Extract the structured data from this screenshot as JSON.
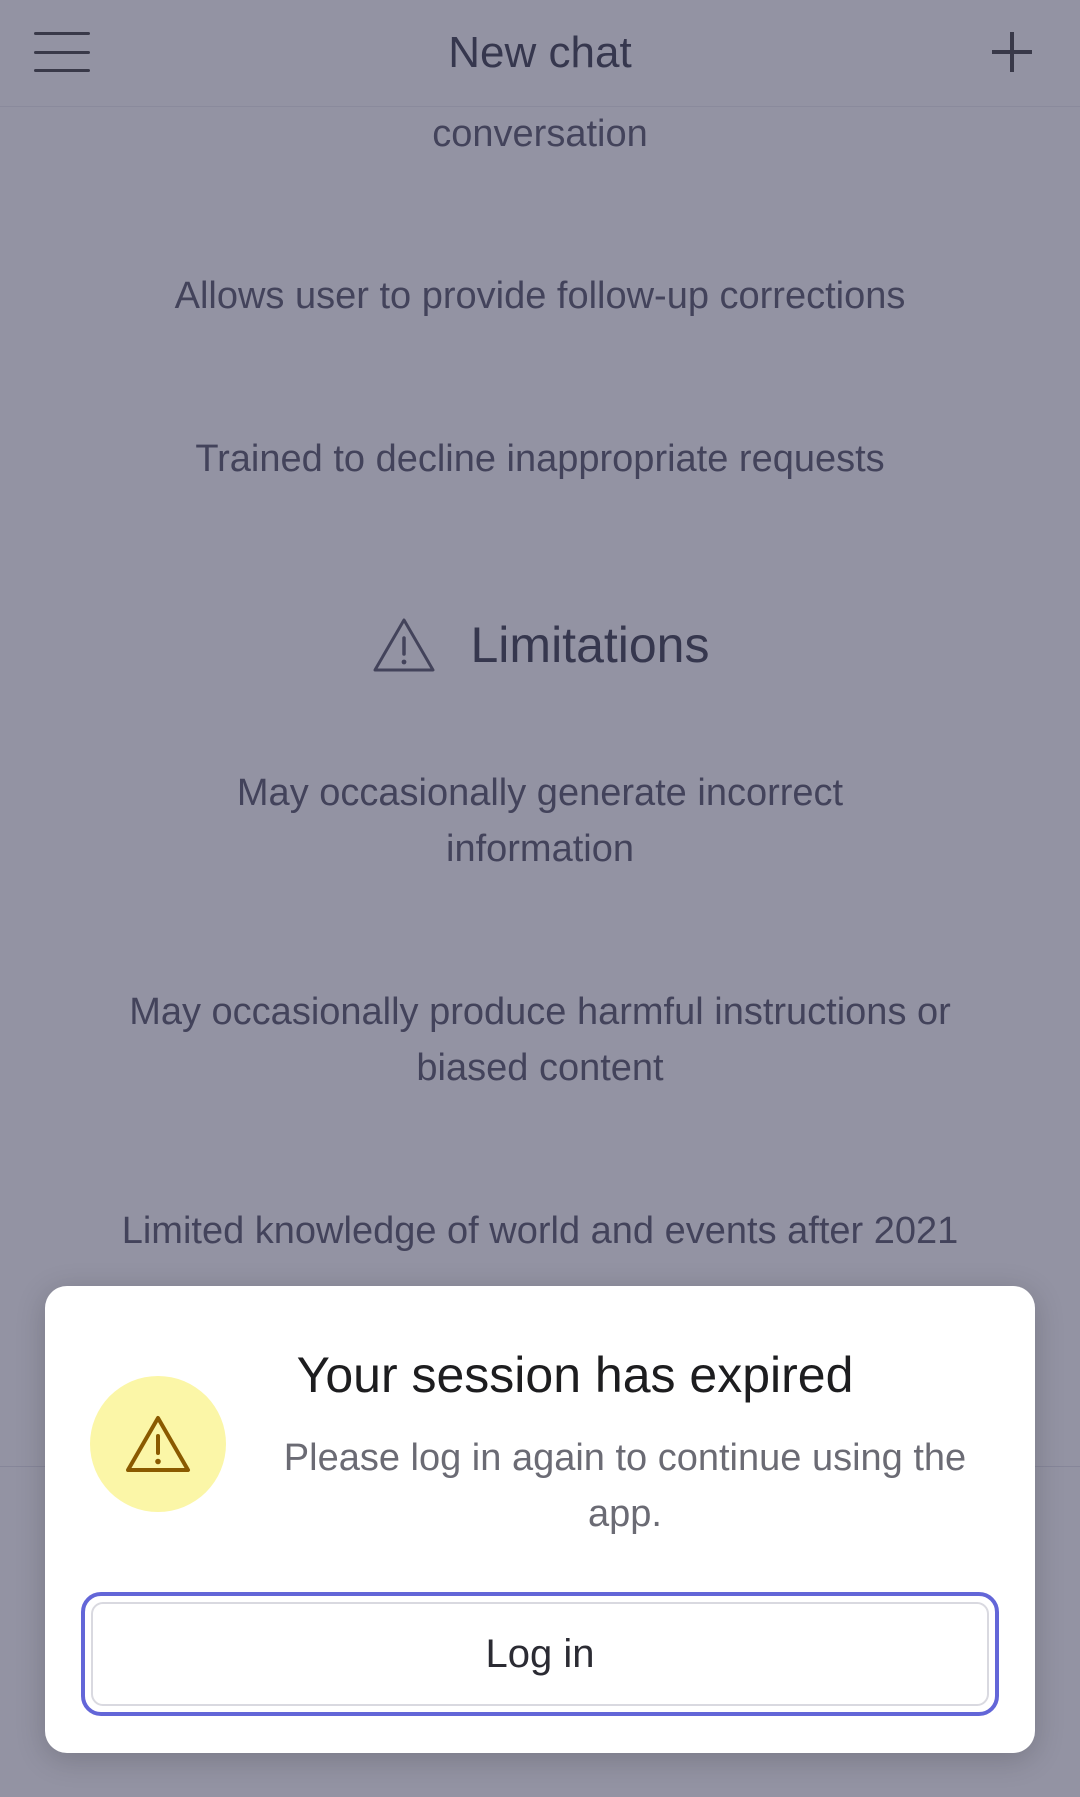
{
  "header": {
    "title": "New chat"
  },
  "content": {
    "items": [
      "conversation",
      "Allows user to provide follow-up corrections",
      "Trained to decline inappropriate requests"
    ],
    "limitations": {
      "title": "Limitations",
      "icon": "warning-triangle-icon",
      "items": [
        "May occasionally generate incorrect information",
        "May occasionally produce harmful instructions or biased content",
        "Limited knowledge of world and events after 2021"
      ]
    }
  },
  "dialog": {
    "title": "Your session has expired",
    "message": "Please log in again to continue using the app.",
    "button_label": "Log in",
    "icon": "warning-icon",
    "colors": {
      "icon_bg": "#fbf6a7",
      "icon_stroke": "#8a5a00",
      "button_border": "#6366d8"
    }
  }
}
